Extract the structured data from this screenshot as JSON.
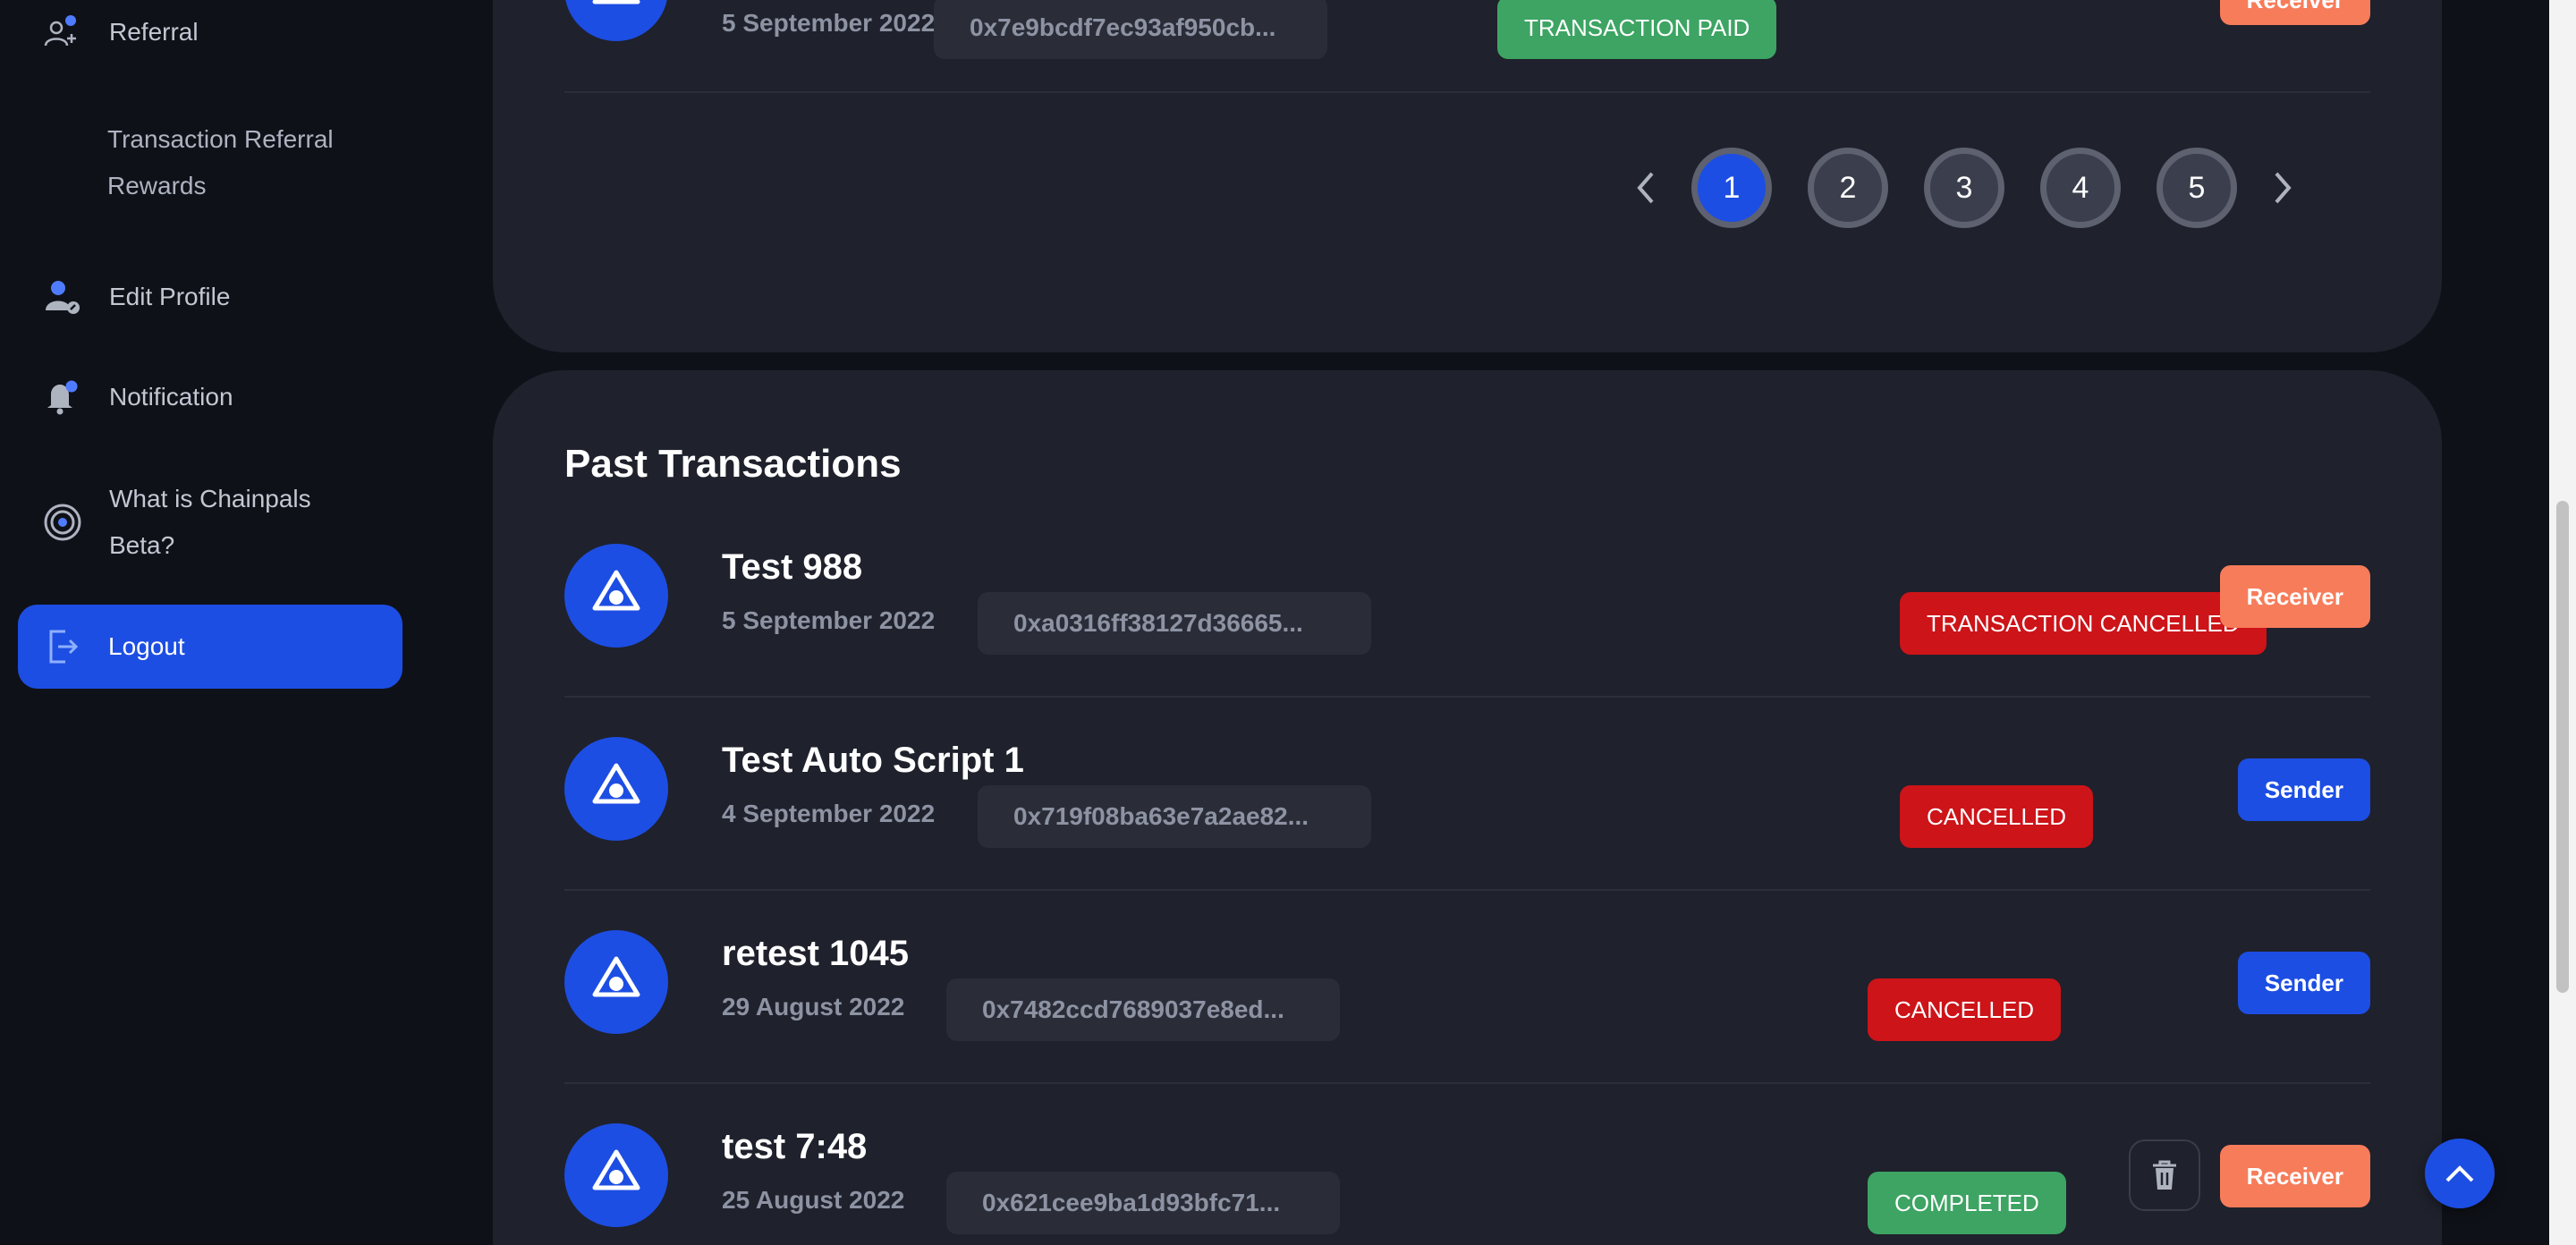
{
  "sidebar": {
    "referral": "Referral",
    "referral_rewards": "Transaction Referral Rewards",
    "edit_profile": "Edit Profile",
    "notification": "Notification",
    "what_is": "What is Chainpals Beta?",
    "logout": "Logout"
  },
  "top_row": {
    "date": "5 September 2022",
    "hash": "0x7e9bcdf7ec93af950cb...",
    "status": "TRANSACTION PAID",
    "role": "Receiver"
  },
  "pagination": {
    "pages": [
      "1",
      "2",
      "3",
      "4",
      "5"
    ],
    "current": "1"
  },
  "past": {
    "title": "Past Transactions",
    "rows": [
      {
        "name": "Test 988",
        "date": "5 September 2022",
        "hash": "0xa0316ff38127d36665...",
        "status": "TRANSACTION CANCELLED",
        "role": "Receiver"
      },
      {
        "name": "Test Auto Script 1",
        "date": "4 September 2022",
        "hash": "0x719f08ba63e7a2ae82...",
        "status": "CANCELLED",
        "role": "Sender"
      },
      {
        "name": "retest 1045",
        "date": "29 August 2022",
        "hash": "0x7482ccd7689037e8ed...",
        "status": "CANCELLED",
        "role": "Sender"
      },
      {
        "name": "test 7:48",
        "date": "25 August 2022",
        "hash": "0x621cee9ba1d93bfc71...",
        "status": "COMPLETED",
        "role": "Receiver"
      }
    ]
  },
  "colors": {
    "accent": "#1d4ee3",
    "receiver": "#f77c5a",
    "cancelled": "#cc1419",
    "paid": "#3da463",
    "panel": "#1f212c",
    "background": "#0f1118"
  }
}
